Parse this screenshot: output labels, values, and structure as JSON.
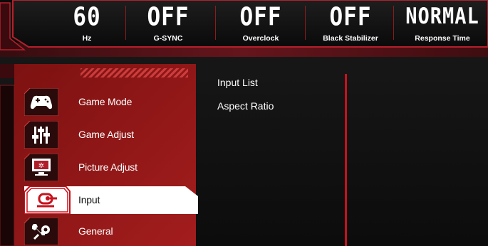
{
  "status": {
    "refresh_value": "60",
    "refresh_label": "Hz",
    "gsync_value": "OFF",
    "gsync_label": "G-SYNC",
    "overclock_value": "OFF",
    "overclock_label": "Overclock",
    "black_stabilizer_value": "OFF",
    "black_stabilizer_label": "Black Stabilizer",
    "response_value": "NORMAL",
    "response_label": "Response Time"
  },
  "menu": {
    "items": [
      {
        "label": "Game Mode",
        "icon": "gamepad-icon"
      },
      {
        "label": "Game Adjust",
        "icon": "sliders-icon"
      },
      {
        "label": "Picture Adjust",
        "icon": "monitor-icon"
      },
      {
        "label": "Input",
        "icon": "input-icon",
        "selected": true
      },
      {
        "label": "General",
        "icon": "wrench-gear-icon"
      }
    ]
  },
  "submenu": {
    "items": [
      "Input List",
      "Aspect Ratio"
    ]
  },
  "colors": {
    "accent_red": "#c8121d",
    "panel_red": "#9a1a1a",
    "selected_bg": "#ffffff"
  }
}
